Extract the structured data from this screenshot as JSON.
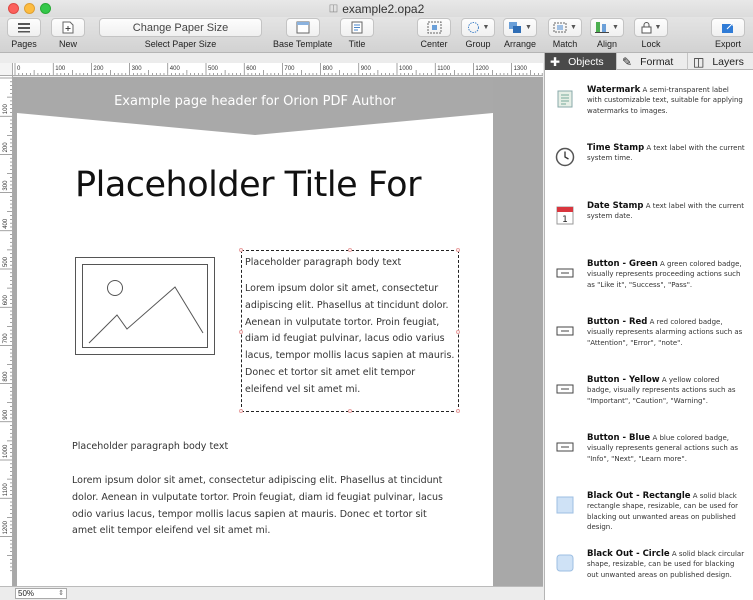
{
  "window": {
    "title": "example2.opa2"
  },
  "toolbar": {
    "pages": "Pages",
    "new": "New",
    "paper_size_value": "Change Paper Size",
    "paper_size_label": "Select Paper Size",
    "base_template": "Base Template",
    "title": "Title",
    "center": "Center",
    "group": "Group",
    "arrange": "Arrange",
    "match": "Match",
    "align": "Align",
    "lock": "Lock",
    "export": "Export"
  },
  "ruler": {
    "top_labels": [
      "0",
      "100",
      "200",
      "300",
      "400",
      "500",
      "600",
      "700",
      "800",
      "900",
      "1000",
      "1100",
      "1200",
      "1300"
    ],
    "left_labels": [
      "100",
      "200",
      "300",
      "400",
      "500",
      "600",
      "700",
      "800",
      "900",
      "1000",
      "1100",
      "1200"
    ]
  },
  "page": {
    "header_text": "Example page header for Orion PDF Author",
    "title": "Placeholder Title For",
    "text_box_title": "Placeholder paragraph body text",
    "text_box_body": "Lorem ipsum dolor sit amet, consectetur adipiscing elit. Phasellus at tincidunt dolor. Aenean in vulputate tortor. Proin feugiat, diam id feugiat pulvinar, lacus odio varius lacus, tempor mollis lacus sapien at mauris. Donec et tortor sit amet elit tempor eleifend vel sit amet mi.",
    "lower_title": "Placeholder paragraph body text",
    "lower_body": "Lorem ipsum dolor sit amet, consectetur adipiscing elit. Phasellus at tincidunt dolor. Aenean in vulputate tortor. Proin feugiat, diam id feugiat pulvinar, lacus odio varius lacus, tempor mollis lacus sapien at mauris. Donec et tortor sit amet elit tempor eleifend vel sit amet mi."
  },
  "status": {
    "zoom": "50%"
  },
  "panel": {
    "tabs": [
      {
        "label": "Objects",
        "icon": "plus-icon"
      },
      {
        "label": "Format",
        "icon": "pencil-icon"
      },
      {
        "label": "Layers",
        "icon": "layers-icon"
      }
    ],
    "objects": [
      {
        "name": "Watermark",
        "desc": "A semi-transparent label with customizable text, suitable for applying watermarks to images.",
        "icon": "watermark-icon"
      },
      {
        "name": "Time Stamp",
        "desc": "A text label with the current system time.",
        "icon": "clock-icon"
      },
      {
        "name": "Date Stamp",
        "desc": "A text label with the current system date.",
        "icon": "calendar-icon"
      },
      {
        "name": "Button - Green",
        "desc": "A green colored badge, visually represents proceeding actions such as \"Like it\", \"Success\", \"Pass\".",
        "icon": "button-icon"
      },
      {
        "name": "Button - Red",
        "desc": "A red colored badge, visually represents alarming actions such as \"Attention\", \"Error\", \"note\".",
        "icon": "button-icon"
      },
      {
        "name": "Button - Yellow",
        "desc": "A yellow colored badge, visually represents actions such as \"Important\", \"Caution\", \"Warning\".",
        "icon": "button-icon"
      },
      {
        "name": "Button - Blue",
        "desc": "A blue colored badge, visually represents general actions such as \"Info\", \"Next\", \"Learn more\".",
        "icon": "button-icon"
      },
      {
        "name": "Black Out - Rectangle",
        "desc": "A solid black rectangle shape, resizable, can be used for blacking out unwanted areas on published design.",
        "icon": "rectangle-icon"
      },
      {
        "name": "Black Out - Circle",
        "desc": "A solid black circular shape, resizable, can be used for blacking out unwanted areas on published design.",
        "icon": "circle-icon"
      }
    ]
  },
  "colors": {
    "header_band": "#a9a9a9",
    "canvas_bg": "#a8a8a8",
    "accent": "#2f7bd6"
  }
}
